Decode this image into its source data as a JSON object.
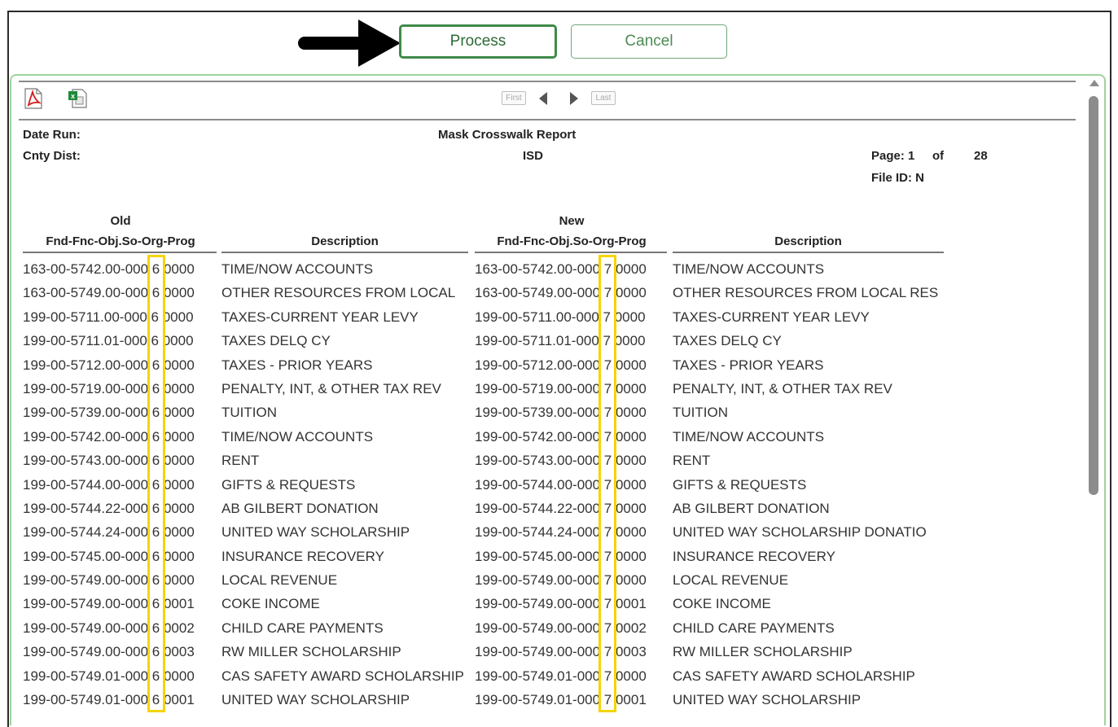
{
  "buttons": {
    "process": "Process",
    "cancel": "Cancel"
  },
  "toolbar": {
    "export_pdf_icon": "pdf-icon",
    "export_excel_icon": "excel-icon",
    "first": "First",
    "last": "Last"
  },
  "report": {
    "date_run_label": "Date Run:",
    "cnty_dist_label": "Cnty Dist:",
    "title": "Mask Crosswalk Report",
    "subtitle": "ISD",
    "page_label": "Page: 1",
    "of_label": "of",
    "total_pages": "28",
    "file_id": "File ID: N"
  },
  "columns": {
    "old_top": "Old",
    "old_bottom": "Fnd-Fnc-Obj.So-Org-Prog",
    "desc1": "Description",
    "new_top": "New",
    "new_bottom": "Fnd-Fnc-Obj.So-Org-Prog",
    "desc2": "Description"
  },
  "rows": [
    [
      "163-00-5742.00-000 6 0000",
      "TIME/NOW ACCOUNTS",
      "163-00-5742.00-000 7 0000",
      "TIME/NOW ACCOUNTS"
    ],
    [
      "163-00-5749.00-000 6 0000",
      "OTHER RESOURCES FROM LOCAL",
      "163-00-5749.00-000 7 0000",
      "OTHER RESOURCES FROM LOCAL RES"
    ],
    [
      "199-00-5711.00-000 6 0000",
      "TAXES-CURRENT YEAR LEVY",
      "199-00-5711.00-000 7 0000",
      "TAXES-CURRENT YEAR LEVY"
    ],
    [
      "199-00-5711.01-000 6 0000",
      "TAXES DELQ CY",
      "199-00-5711.01-000 7 0000",
      "TAXES DELQ CY"
    ],
    [
      "199-00-5712.00-000 6 0000",
      "TAXES - PRIOR YEARS",
      "199-00-5712.00-000 7 0000",
      "TAXES - PRIOR YEARS"
    ],
    [
      "199-00-5719.00-000 6 0000",
      "PENALTY, INT, & OTHER TAX REV",
      "199-00-5719.00-000 7 0000",
      "PENALTY, INT, & OTHER TAX REV"
    ],
    [
      "199-00-5739.00-000 6 0000",
      "TUITION",
      "199-00-5739.00-000 7 0000",
      "TUITION"
    ],
    [
      "199-00-5742.00-000 6 0000",
      "TIME/NOW ACCOUNTS",
      "199-00-5742.00-000 7 0000",
      "TIME/NOW ACCOUNTS"
    ],
    [
      "199-00-5743.00-000 6 0000",
      "RENT",
      "199-00-5743.00-000 7 0000",
      "RENT"
    ],
    [
      "199-00-5744.00-000 6 0000",
      "GIFTS & REQUESTS",
      "199-00-5744.00-000 7 0000",
      "GIFTS & REQUESTS"
    ],
    [
      "199-00-5744.22-000 6 0000",
      "AB GILBERT DONATION",
      "199-00-5744.22-000 7 0000",
      "AB GILBERT DONATION"
    ],
    [
      "199-00-5744.24-000 6 0000",
      "UNITED WAY SCHOLARSHIP",
      "199-00-5744.24-000 7 0000",
      "UNITED WAY SCHOLARSHIP DONATIO"
    ],
    [
      "199-00-5745.00-000 6 0000",
      "INSURANCE RECOVERY",
      "199-00-5745.00-000 7 0000",
      "INSURANCE RECOVERY"
    ],
    [
      "199-00-5749.00-000 6 0000",
      "LOCAL REVENUE",
      "199-00-5749.00-000 7 0000",
      "LOCAL REVENUE"
    ],
    [
      "199-00-5749.00-000 6 0001",
      "COKE INCOME",
      "199-00-5749.00-000 7 0001",
      "COKE INCOME"
    ],
    [
      "199-00-5749.00-000 6 0002",
      "CHILD CARE PAYMENTS",
      "199-00-5749.00-000 7 0002",
      "CHILD CARE PAYMENTS"
    ],
    [
      "199-00-5749.00-000 6 0003",
      "RW MILLER SCHOLARSHIP",
      "199-00-5749.00-000 7 0003",
      "RW MILLER SCHOLARSHIP"
    ],
    [
      "199-00-5749.01-000 6 0000",
      "CAS SAFETY AWARD SCHOLARSHIP",
      "199-00-5749.01-000 7 0000",
      "CAS SAFETY AWARD SCHOLARSHIP"
    ],
    [
      "199-00-5749.01-000 6 0001",
      "UNITED WAY SCHOLARSHIP",
      "199-00-5749.01-000 7 0001",
      "UNITED WAY SCHOLARSHIP"
    ]
  ],
  "colors": {
    "highlight": "#f5d400",
    "button_border": "#3f8a4a",
    "panel_border": "#9fd39f"
  }
}
